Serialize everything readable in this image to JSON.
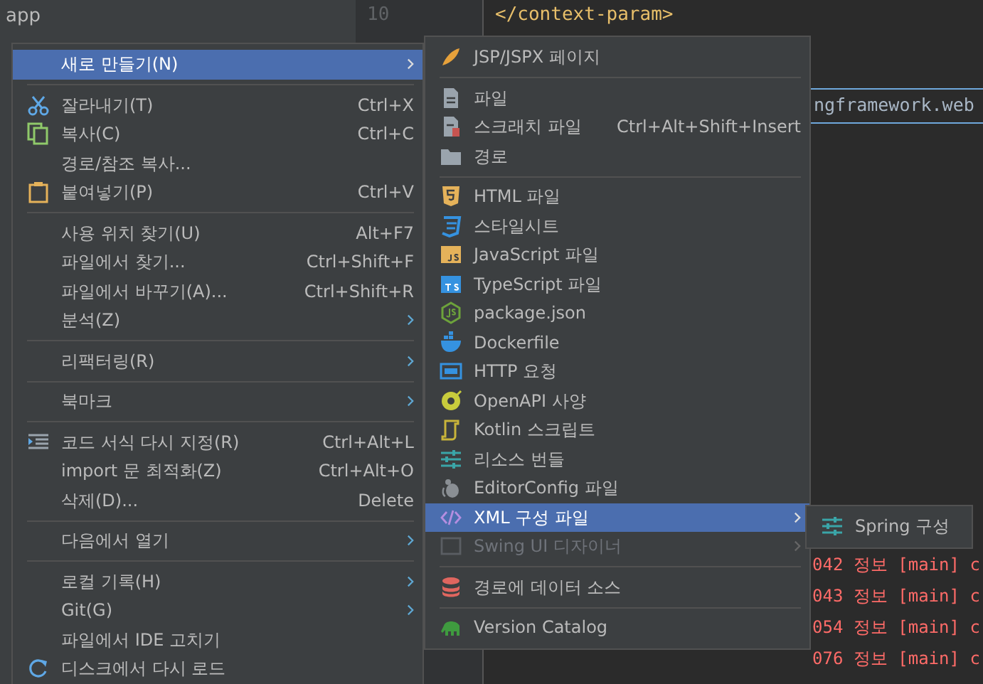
{
  "project": {
    "title": "app"
  },
  "editor": {
    "line_number": "10",
    "lines": [
      "</context-param>",
      "ngframework.web"
    ]
  },
  "console": {
    "lines": [
      "042 정보 [main] c",
      "043 정보 [main] c",
      "054 정보 [main] c",
      "076 정보 [main] c"
    ]
  },
  "context_menu": [
    {
      "kind": "item",
      "label": "새로 만들기(N)",
      "submenu": true,
      "selected": true
    },
    {
      "kind": "separator"
    },
    {
      "kind": "item",
      "label": "잘라내기(T)",
      "shortcut": "Ctrl+X",
      "selected": false
    },
    {
      "kind": "item",
      "label": "복사(C)",
      "shortcut": "Ctrl+C",
      "selected": false
    },
    {
      "kind": "item",
      "label": "경로/참조 복사...",
      "selected": false
    },
    {
      "kind": "item",
      "label": "붙여넣기(P)",
      "shortcut": "Ctrl+V",
      "selected": false
    },
    {
      "kind": "separator"
    },
    {
      "kind": "item",
      "label": "사용 위치 찾기(U)",
      "shortcut": "Alt+F7",
      "selected": false
    },
    {
      "kind": "item",
      "label": "파일에서 찾기...",
      "shortcut": "Ctrl+Shift+F",
      "selected": false
    },
    {
      "kind": "item",
      "label": "파일에서 바꾸기(A)...",
      "shortcut": "Ctrl+Shift+R",
      "selected": false
    },
    {
      "kind": "item",
      "label": "분석(Z)",
      "submenu": true,
      "selected": false
    },
    {
      "kind": "separator"
    },
    {
      "kind": "item",
      "label": "리팩터링(R)",
      "submenu": true,
      "selected": false
    },
    {
      "kind": "separator"
    },
    {
      "kind": "item",
      "label": "북마크",
      "submenu": true,
      "selected": false
    },
    {
      "kind": "separator"
    },
    {
      "kind": "item",
      "label": "코드 서식 다시 지정(R)",
      "shortcut": "Ctrl+Alt+L",
      "selected": false
    },
    {
      "kind": "item",
      "label": "import 문 최적화(Z)",
      "shortcut": "Ctrl+Alt+O",
      "selected": false
    },
    {
      "kind": "item",
      "label": "삭제(D)...",
      "shortcut": "Delete",
      "selected": false
    },
    {
      "kind": "separator"
    },
    {
      "kind": "item",
      "label": "다음에서 열기",
      "submenu": true,
      "selected": false
    },
    {
      "kind": "separator"
    },
    {
      "kind": "item",
      "label": "로컬 기록(H)",
      "submenu": true,
      "selected": false
    },
    {
      "kind": "item",
      "label": "Git(G)",
      "submenu": true,
      "selected": false
    },
    {
      "kind": "item",
      "label": "파일에서 IDE 고치기",
      "selected": false
    },
    {
      "kind": "item",
      "label": "디스크에서 다시 로드",
      "selected": false
    }
  ],
  "new_submenu": [
    {
      "kind": "item",
      "label": "JSP/JSPX 페이지",
      "selected": false
    },
    {
      "kind": "separator"
    },
    {
      "kind": "item",
      "label": "파일",
      "selected": false
    },
    {
      "kind": "item",
      "label": "스크래치 파일",
      "shortcut": "Ctrl+Alt+Shift+Insert",
      "selected": false
    },
    {
      "kind": "item",
      "label": "경로",
      "selected": false
    },
    {
      "kind": "separator"
    },
    {
      "kind": "item",
      "label": "HTML 파일",
      "selected": false
    },
    {
      "kind": "item",
      "label": "스타일시트",
      "selected": false
    },
    {
      "kind": "item",
      "label": "JavaScript 파일",
      "selected": false
    },
    {
      "kind": "item",
      "label": "TypeScript 파일",
      "selected": false
    },
    {
      "kind": "item",
      "label": "package.json",
      "selected": false
    },
    {
      "kind": "item",
      "label": "Dockerfile",
      "selected": false
    },
    {
      "kind": "item",
      "label": "HTTP 요청",
      "selected": false
    },
    {
      "kind": "item",
      "label": "OpenAPI 사양",
      "selected": false
    },
    {
      "kind": "item",
      "label": "Kotlin 스크립트",
      "selected": false
    },
    {
      "kind": "item",
      "label": "리소스 번들",
      "selected": false
    },
    {
      "kind": "item",
      "label": "EditorConfig 파일",
      "selected": false
    },
    {
      "kind": "item",
      "label": "XML 구성 파일",
      "submenu": true,
      "selected": true
    },
    {
      "kind": "item",
      "label": "Swing UI 디자이너",
      "submenu": true,
      "selected": false,
      "disabled": true
    },
    {
      "kind": "separator"
    },
    {
      "kind": "item",
      "label": "경로에 데이터 소스",
      "selected": false
    },
    {
      "kind": "separator"
    },
    {
      "kind": "item",
      "label": "Version Catalog",
      "selected": false
    }
  ],
  "xml_submenu": [
    {
      "kind": "item",
      "label": "Spring 구성",
      "selected": false
    }
  ]
}
